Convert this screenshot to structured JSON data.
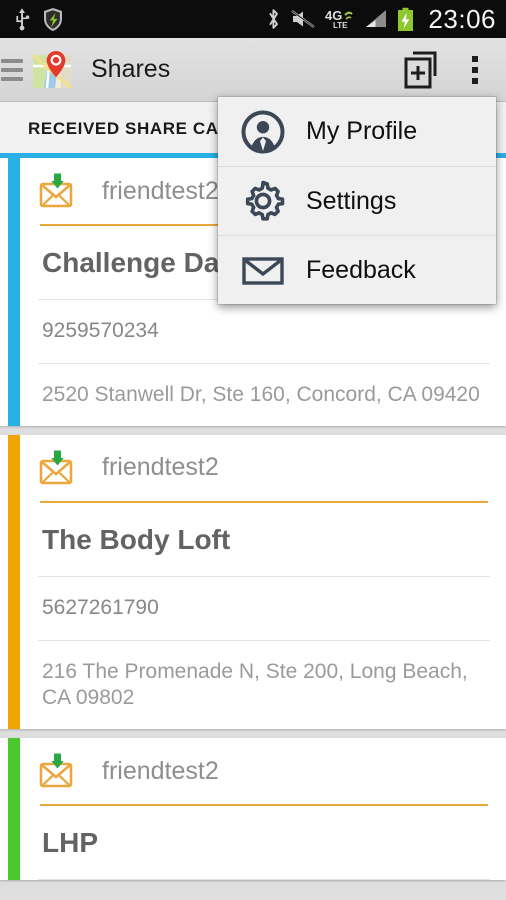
{
  "status_bar": {
    "time": "23:06",
    "left_icons": [
      "usb-icon",
      "shield-icon"
    ],
    "right_icons": [
      "bluetooth-icon",
      "ringer-muted-icon",
      "4g-lte-icon",
      "signal-bars-icon",
      "battery-charging-icon"
    ],
    "network_label": "4G",
    "network_sub": "LTE"
  },
  "action_bar": {
    "title": "Shares",
    "menu_icon": "hamburger-menu-icon",
    "app_icon": "maps-location-icon",
    "add_card_icon": "add-share-card-icon",
    "overflow_icon": "overflow-menu-icon"
  },
  "tabs": [
    {
      "label": "RECEIVED SHARE CARD",
      "selected": true
    }
  ],
  "overflow_menu": {
    "visible": true,
    "items": [
      {
        "label": "My Profile",
        "icon": "person-profile-icon"
      },
      {
        "label": "Settings",
        "icon": "gear-icon"
      },
      {
        "label": "Feedback",
        "icon": "envelope-icon"
      }
    ]
  },
  "cards": [
    {
      "sender": "friendtest2",
      "title": "Challenge Day",
      "phone": "9259570234",
      "address": "2520 Stanwell Dr, Ste 160, Concord, CA 09420",
      "stripe_color": "#29b0e5",
      "envelope_icon": "received-envelope-icon"
    },
    {
      "sender": "friendtest2",
      "title": "The Body Loft",
      "phone": "5627261790",
      "address": "216 The Promenade N, Ste 200, Long Beach, CA 09802",
      "stripe_color": "#f0a400",
      "envelope_icon": "received-envelope-icon"
    },
    {
      "sender": "friendtest2",
      "title": "LHP",
      "phone": "",
      "address": "",
      "stripe_color": "#4cc82e",
      "envelope_icon": "received-envelope-icon"
    }
  ],
  "colors": {
    "accent_blue": "#29b0e5",
    "accent_orange": "#f0a400",
    "accent_green": "#4cc82e",
    "envelope_orange": "#eaa83c",
    "download_green": "#2aa844",
    "menu_icon_navy": "#3c4857"
  }
}
